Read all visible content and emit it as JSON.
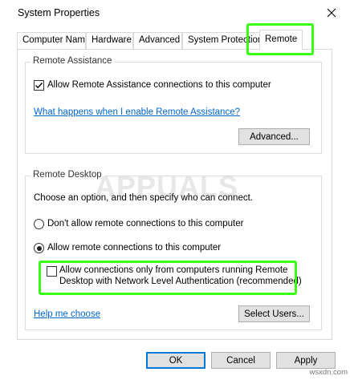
{
  "window": {
    "title": "System Properties"
  },
  "tabs": [
    {
      "label": "Computer Name"
    },
    {
      "label": "Hardware"
    },
    {
      "label": "Advanced"
    },
    {
      "label": "System Protection"
    },
    {
      "label": "Remote"
    }
  ],
  "remote_assistance": {
    "legend": "Remote Assistance",
    "allow_label": "Allow Remote Assistance connections to this computer",
    "allow_checked": true,
    "help_link": "What happens when I enable Remote Assistance?",
    "advanced_button": "Advanced..."
  },
  "remote_desktop": {
    "legend": "Remote Desktop",
    "intro": "Choose an option, and then specify who can connect.",
    "option_deny": "Don't allow remote connections to this computer",
    "option_allow": "Allow remote connections to this computer",
    "selected": "allow",
    "nla_label_line1": "Allow connections only from computers running Remote",
    "nla_label_line2": "Desktop with Network Level Authentication (recommended)",
    "nla_checked": false,
    "help_link": "Help me choose",
    "select_users_button": "Select Users..."
  },
  "footer": {
    "ok_label": "OK",
    "cancel_label": "Cancel",
    "apply_label": "Apply"
  },
  "watermark": "APPUALS",
  "site_tag": "wsxdn.com",
  "colors": {
    "highlight": "#39ff14",
    "link": "#0066cc",
    "default_button_border": "#0078d7"
  }
}
